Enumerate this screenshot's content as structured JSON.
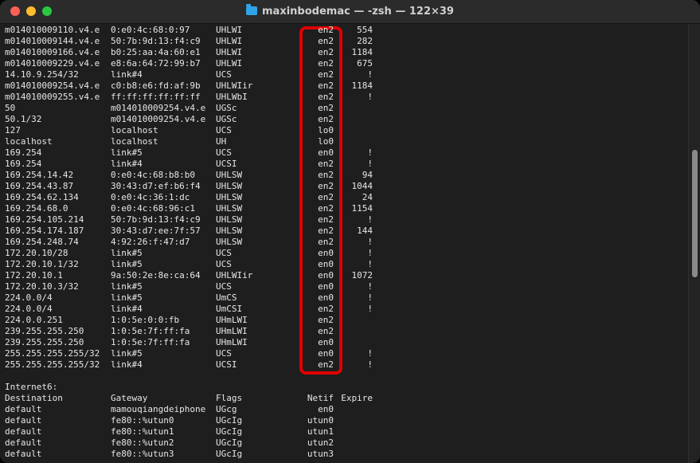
{
  "window": {
    "title": "maxinbodemac — -zsh — 122×39"
  },
  "colors": {
    "background": "#1e1e1e",
    "text": "#e6e6e6",
    "highlight": "#e00000"
  },
  "icons": {
    "title": "folder-icon"
  },
  "routes": [
    {
      "dest": "m014010009110.v4.e",
      "gateway": "0:e0:4c:68:0:97",
      "flags": "UHLWI",
      "netif": "en2",
      "expire": "554"
    },
    {
      "dest": "m014010009144.v4.e",
      "gateway": "50:7b:9d:13:f4:c9",
      "flags": "UHLWI",
      "netif": "en2",
      "expire": "282"
    },
    {
      "dest": "m014010009166.v4.e",
      "gateway": "b0:25:aa:4a:60:e1",
      "flags": "UHLWI",
      "netif": "en2",
      "expire": "1184"
    },
    {
      "dest": "m014010009229.v4.e",
      "gateway": "e8:6a:64:72:99:b7",
      "flags": "UHLWI",
      "netif": "en2",
      "expire": "675"
    },
    {
      "dest": "14.10.9.254/32",
      "gateway": "link#4",
      "flags": "UCS",
      "netif": "en2",
      "expire": "!"
    },
    {
      "dest": "m014010009254.v4.e",
      "gateway": "c0:b8:e6:fd:af:9b",
      "flags": "UHLWIir",
      "netif": "en2",
      "expire": "1184"
    },
    {
      "dest": "m014010009255.v4.e",
      "gateway": "ff:ff:ff:ff:ff:ff",
      "flags": "UHLWbI",
      "netif": "en2",
      "expire": "!"
    },
    {
      "dest": "50",
      "gateway": "m014010009254.v4.e",
      "flags": "UGSc",
      "netif": "en2",
      "expire": ""
    },
    {
      "dest": "50.1/32",
      "gateway": "m014010009254.v4.e",
      "flags": "UGSc",
      "netif": "en2",
      "expire": ""
    },
    {
      "dest": "127",
      "gateway": "localhost",
      "flags": "UCS",
      "netif": "lo0",
      "expire": ""
    },
    {
      "dest": "localhost",
      "gateway": "localhost",
      "flags": "UH",
      "netif": "lo0",
      "expire": ""
    },
    {
      "dest": "169.254",
      "gateway": "link#5",
      "flags": "UCS",
      "netif": "en0",
      "expire": "!"
    },
    {
      "dest": "169.254",
      "gateway": "link#4",
      "flags": "UCSI",
      "netif": "en2",
      "expire": "!"
    },
    {
      "dest": "169.254.14.42",
      "gateway": "0:e0:4c:68:b8:b0",
      "flags": "UHLSW",
      "netif": "en2",
      "expire": "94"
    },
    {
      "dest": "169.254.43.87",
      "gateway": "30:43:d7:ef:b6:f4",
      "flags": "UHLSW",
      "netif": "en2",
      "expire": "1044"
    },
    {
      "dest": "169.254.62.134",
      "gateway": "0:e0:4c:36:1:dc",
      "flags": "UHLSW",
      "netif": "en2",
      "expire": "24"
    },
    {
      "dest": "169.254.68.0",
      "gateway": "0:e0:4c:68:96:c1",
      "flags": "UHLSW",
      "netif": "en2",
      "expire": "1154"
    },
    {
      "dest": "169.254.105.214",
      "gateway": "50:7b:9d:13:f4:c9",
      "flags": "UHLSW",
      "netif": "en2",
      "expire": "!"
    },
    {
      "dest": "169.254.174.187",
      "gateway": "30:43:d7:ee:7f:57",
      "flags": "UHLSW",
      "netif": "en2",
      "expire": "144"
    },
    {
      "dest": "169.254.248.74",
      "gateway": "4:92:26:f:47:d7",
      "flags": "UHLSW",
      "netif": "en2",
      "expire": "!"
    },
    {
      "dest": "172.20.10/28",
      "gateway": "link#5",
      "flags": "UCS",
      "netif": "en0",
      "expire": "!"
    },
    {
      "dest": "172.20.10.1/32",
      "gateway": "link#5",
      "flags": "UCS",
      "netif": "en0",
      "expire": "!"
    },
    {
      "dest": "172.20.10.1",
      "gateway": "9a:50:2e:8e:ca:64",
      "flags": "UHLWIir",
      "netif": "en0",
      "expire": "1072"
    },
    {
      "dest": "172.20.10.3/32",
      "gateway": "link#5",
      "flags": "UCS",
      "netif": "en0",
      "expire": "!"
    },
    {
      "dest": "224.0.0/4",
      "gateway": "link#5",
      "flags": "UmCS",
      "netif": "en0",
      "expire": "!"
    },
    {
      "dest": "224.0.0/4",
      "gateway": "link#4",
      "flags": "UmCSI",
      "netif": "en2",
      "expire": "!"
    },
    {
      "dest": "224.0.0.251",
      "gateway": "1:0:5e:0:0:fb",
      "flags": "UHmLWI",
      "netif": "en2",
      "expire": ""
    },
    {
      "dest": "239.255.255.250",
      "gateway": "1:0:5e:7f:ff:fa",
      "flags": "UHmLWI",
      "netif": "en2",
      "expire": ""
    },
    {
      "dest": "239.255.255.250",
      "gateway": "1:0:5e:7f:ff:fa",
      "flags": "UHmLWI",
      "netif": "en0",
      "expire": ""
    },
    {
      "dest": "255.255.255.255/32",
      "gateway": "link#5",
      "flags": "UCS",
      "netif": "en0",
      "expire": "!"
    },
    {
      "dest": "255.255.255.255/32",
      "gateway": "link#4",
      "flags": "UCSI",
      "netif": "en2",
      "expire": "!"
    }
  ],
  "internet6": {
    "label": "Internet6:",
    "headers": {
      "dest": "Destination",
      "gateway": "Gateway",
      "flags": "Flags",
      "netif": "Netif",
      "expire": "Expire"
    },
    "routes": [
      {
        "dest": "default",
        "gateway": "mamouqiangdeiphone",
        "flags": "UGcg",
        "netif": "en0",
        "expire": ""
      },
      {
        "dest": "default",
        "gateway": "fe80::%utun0",
        "flags": "UGcIg",
        "netif": "utun0",
        "expire": ""
      },
      {
        "dest": "default",
        "gateway": "fe80::%utun1",
        "flags": "UGcIg",
        "netif": "utun1",
        "expire": ""
      },
      {
        "dest": "default",
        "gateway": "fe80::%utun2",
        "flags": "UGcIg",
        "netif": "utun2",
        "expire": ""
      },
      {
        "dest": "default",
        "gateway": "fe80::%utun3",
        "flags": "UGcIg",
        "netif": "utun3",
        "expire": ""
      }
    ]
  }
}
